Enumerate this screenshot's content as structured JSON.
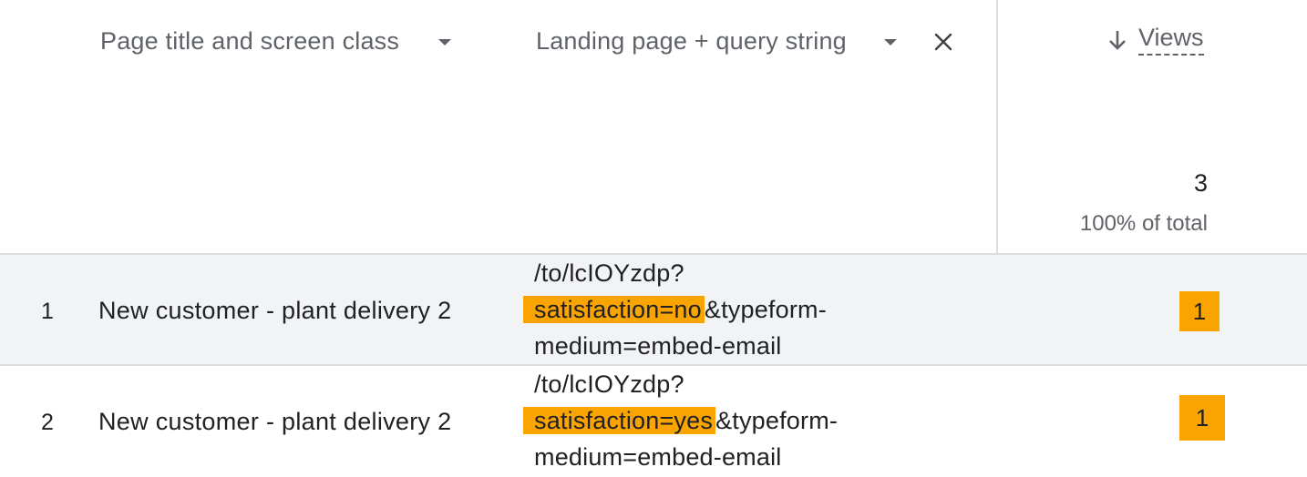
{
  "header": {
    "dimension1_label": "Page title and screen class",
    "dimension2_label": "Landing page + query string",
    "metric_label": "Views",
    "metric_total": "3",
    "metric_total_pct": "100% of total"
  },
  "rows": [
    {
      "index": "1",
      "page_title": "New customer - plant delivery 2",
      "landing_line1": "/to/lcIOYzdp?",
      "landing_highlight": "satisfaction=no",
      "landing_rest": "&typeform-",
      "landing_line3": "medium=embed-email",
      "views": "1"
    },
    {
      "index": "2",
      "page_title": "New customer - plant delivery 2",
      "landing_line1": "/to/lcIOYzdp?",
      "landing_highlight": "satisfaction=yes",
      "landing_rest": "&typeform-",
      "landing_line3": "medium=embed-email",
      "views": "1"
    }
  ],
  "colors": {
    "highlight": "#f9a400",
    "row_alt_bg": "#f1f3f4",
    "divider": "#dadce0"
  }
}
